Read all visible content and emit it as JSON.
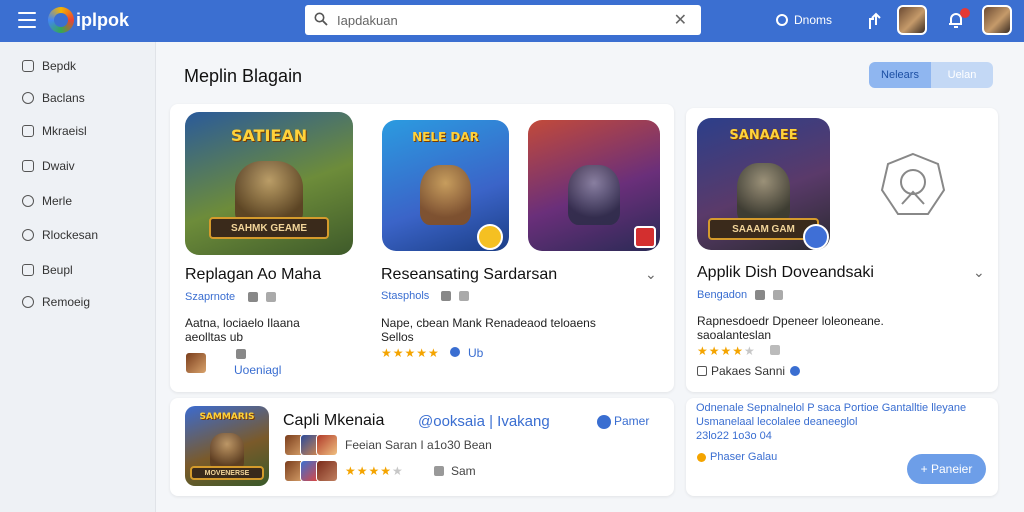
{
  "topbar": {
    "brand": "iplpok",
    "search_value": "Iapdakuan",
    "right_link": "Dnoms",
    "colors": {
      "bar": "#3b6fd1",
      "badge": "#e53935"
    }
  },
  "sidebar": {
    "items": [
      {
        "label": "Bepdk",
        "icon": "list-icon"
      },
      {
        "label": "Baclans",
        "icon": "circle-icon"
      },
      {
        "label": "Mkraeisl",
        "icon": "square-icon"
      },
      {
        "label": "Dwaiv",
        "icon": "square-icon"
      },
      {
        "label": "Merle",
        "icon": "circle-icon"
      },
      {
        "label": "Rlockesan",
        "icon": "bell-icon"
      },
      {
        "label": "Beupl",
        "icon": "square-icon"
      },
      {
        "label": "Remoeig",
        "icon": "circle-icon"
      }
    ]
  },
  "main": {
    "title": "Meplin Blagain",
    "segmented": [
      "Nelears",
      "Uelan"
    ]
  },
  "cards": {
    "c1": {
      "thumb_title": "SATIEAN",
      "thumb_plate": "SAHMK GEAME",
      "title": "Replagan Ao Maha",
      "dev": "Szaprnote",
      "desc": [
        "Aatna, lociaelo Ilaana",
        "aeolltas ub"
      ],
      "link": "Uoeniagl"
    },
    "c2": {
      "thumb_title": "NELE DAR",
      "title": "Reseansating Sardarsan",
      "dev": "Stasphols",
      "desc": [
        "Nape, cbean Mank Renadeaod teloaens",
        "Sellos"
      ],
      "stars": "★★★★★",
      "meta": "Ub"
    },
    "c3": {
      "thumb_title": "SANAAEE",
      "thumb_plate": "SAAAM GAM",
      "title": "Applik Dish Doveandsaki",
      "dev": "Bengadon",
      "desc": [
        "Rapnesdoedr Dpeneer loleoneane.",
        "saoalanteslan"
      ],
      "stars_on": "★★★★",
      "stars_off": "★",
      "link": "Pakaes Sanni"
    },
    "c4": {
      "thumb_title": "SAMMARIS",
      "thumb_plate": "MOVENERSE",
      "title": "Capli Mkenaia",
      "handle": "@ooksaia | Ivakang",
      "action": "Pamer",
      "meta1": "Feeian Saran I a1o30 Bean",
      "stars_on": "★★★★",
      "stars_off": "★",
      "meta2": "Sam"
    },
    "c5": {
      "lines": [
        "Odnenale Sepnalnelol P saca Portioe Gantalltie lleyane",
        "Usmanelaal lecolalee deaneeglol",
        "23lo22 1o3o 04"
      ],
      "status": "Phaser Galau",
      "button": "+ Paneier"
    }
  }
}
